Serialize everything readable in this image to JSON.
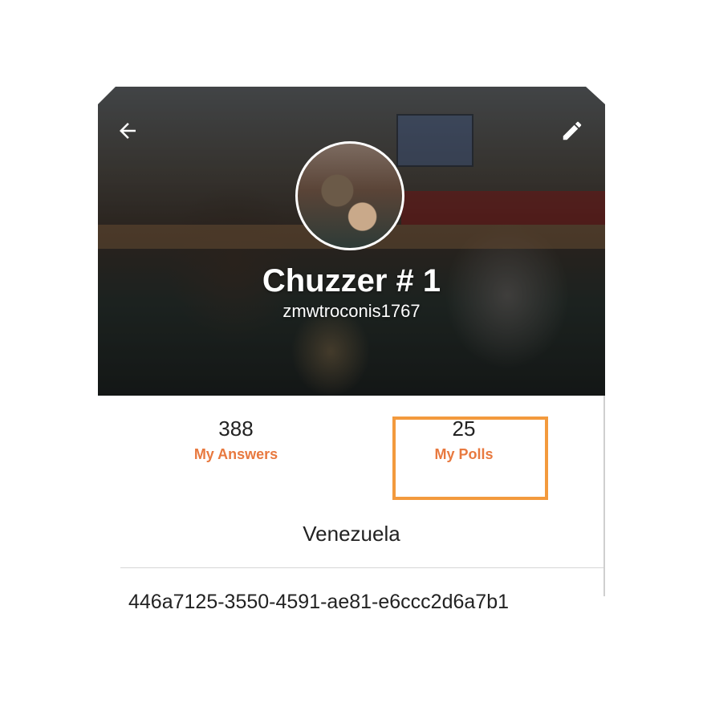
{
  "profile": {
    "name": "Chuzzer # 1",
    "username": "zmwtroconis1767"
  },
  "header": {
    "back_icon": "arrow-left-icon",
    "edit_icon": "pencil-icon"
  },
  "stats": {
    "answers": {
      "count": "388",
      "label": "My Answers"
    },
    "polls": {
      "count": "25",
      "label": "My Polls"
    }
  },
  "details": {
    "country": "Venezuela",
    "user_id": "446a7125-3550-4591-ae81-e6ccc2d6a7b1"
  },
  "colors": {
    "accent": "#e8793f",
    "highlight": "#f39a3d"
  }
}
